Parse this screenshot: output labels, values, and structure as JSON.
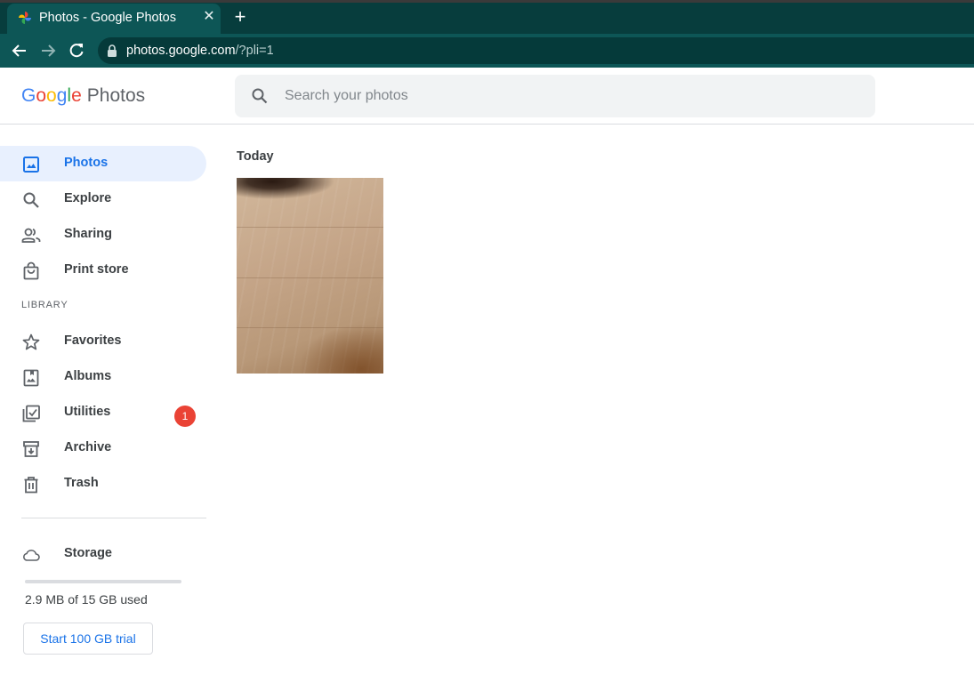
{
  "browser": {
    "tab_title": "Photos - Google Photos",
    "close_glyph": "✕",
    "newtab_glyph": "+",
    "url_host": "photos.google.com",
    "url_path": "/?pli=1"
  },
  "header": {
    "logo_letters": [
      "G",
      "o",
      "o",
      "g",
      "l",
      "e"
    ],
    "product": "Photos",
    "search_placeholder": "Search your photos"
  },
  "sidebar": {
    "items": [
      {
        "label": "Photos",
        "icon": "photo-icon",
        "active": true
      },
      {
        "label": "Explore",
        "icon": "search-icon"
      },
      {
        "label": "Sharing",
        "icon": "people-icon"
      },
      {
        "label": "Print store",
        "icon": "shopping-bag-icon"
      }
    ],
    "library_label": "LIBRARY",
    "library_items": [
      {
        "label": "Favorites",
        "icon": "star-icon"
      },
      {
        "label": "Albums",
        "icon": "album-icon"
      },
      {
        "label": "Utilities",
        "icon": "utilities-icon",
        "badge": "1"
      },
      {
        "label": "Archive",
        "icon": "archive-icon"
      },
      {
        "label": "Trash",
        "icon": "trash-icon"
      }
    ],
    "storage": {
      "label": "Storage",
      "icon": "cloud-icon",
      "used_text": "2.9 MB of 15 GB used",
      "used_fraction": 0.0002,
      "trial_button": "Start 100 GB trial"
    }
  },
  "main": {
    "date_header": "Today"
  },
  "colors": {
    "accent": "#1a73e8",
    "active_bg": "#e8f0fe",
    "badge": "#ea4335",
    "browser_frame": "#0d5656"
  }
}
